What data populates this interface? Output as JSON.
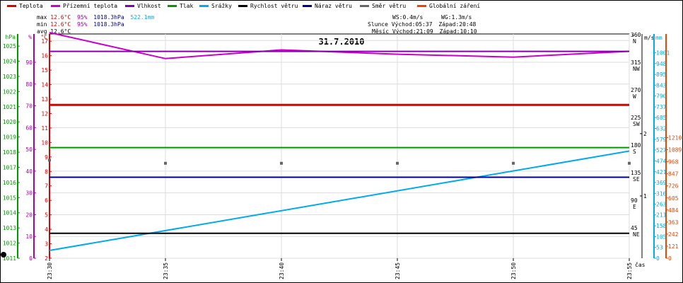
{
  "legend": [
    {
      "label": "Teplota",
      "color": "#dd0000"
    },
    {
      "label": "Přízemní teplota",
      "color": "#cc00cc"
    },
    {
      "label": "Vlhkost",
      "color": "#8800aa"
    },
    {
      "label": "Tlak",
      "color": "#009900"
    },
    {
      "label": "Srážky",
      "color": "#00aaee"
    },
    {
      "label": "Rychlost větru",
      "color": "#000000"
    },
    {
      "label": "Náraz větru",
      "color": "#00008b"
    },
    {
      "label": "Směr větru",
      "color": "#666666"
    },
    {
      "label": "Globální záření",
      "color": "#ee4400"
    }
  ],
  "stats": {
    "max_label": "max",
    "max_temp": "12.6°C",
    "max_hum": "95%",
    "max_press": "1018.3hPa",
    "max_rain": "522.1mm",
    "min_label": "min",
    "min_temp": "12.6°C",
    "min_hum": "95%",
    "min_press": "1018.3hPa",
    "avg_label": "avg",
    "avg_temp": "12.6°C",
    "ws": "WS:0.4m/s",
    "wg": "WG:1.3m/s",
    "sun_label": "Slunce",
    "sun_rise": "Východ:05:37",
    "sun_set": "Západ:20:48",
    "moon_label": "Měsíc",
    "moon_rise": "Východ:21:09",
    "moon_set": "Západ:10:10"
  },
  "axis_units": {
    "hpa": "hPa",
    "pct": "%",
    "deg_c": "°C",
    "deg": "°",
    "ms": "m/s",
    "mm": "mm",
    "cas": "čas"
  },
  "colors": {
    "pressure_axis": "#009900",
    "humidity_axis": "#aa00aa",
    "temp_axis": "#dd0000",
    "rain_axis": "#00aaee",
    "radiation_axis": "#ee4400",
    "grid": "#dddddd"
  },
  "chart_data": {
    "type": "line",
    "title": "31.7.2010",
    "x": [
      "23:30",
      "23:35",
      "23:40",
      "23:45",
      "23:50",
      "23:55"
    ],
    "axes": {
      "pressure_hpa": {
        "ticks": [
          1011,
          1012,
          1013,
          1014,
          1015,
          1016,
          1017,
          1018,
          1019,
          1020,
          1021,
          1022,
          1023,
          1024,
          1025
        ],
        "range": [
          1011,
          1025.8
        ]
      },
      "humidity_pct": {
        "ticks": [
          0,
          10,
          20,
          30,
          40,
          50,
          60,
          70,
          80,
          90,
          100
        ],
        "range": [
          0,
          103
        ]
      },
      "temperature_c": {
        "ticks": [
          2,
          3,
          4,
          5,
          6,
          7,
          8,
          9,
          10,
          11,
          12,
          13,
          14,
          15,
          16,
          17
        ],
        "range": [
          2,
          17.5
        ]
      },
      "wind_direction_deg": {
        "ticks": [
          45,
          90,
          135,
          180,
          225,
          270,
          315,
          360
        ],
        "labels": [
          "NE",
          "E",
          "SE",
          "S",
          "SW",
          "W",
          "NW",
          "N"
        ],
        "range": [
          0,
          366
        ]
      },
      "wind_speed_ms": {
        "ticks": [
          1,
          2
        ],
        "range": [
          0,
          3.6
        ]
      },
      "rain_mm": {
        "ticks": [
          0,
          53,
          105,
          158,
          211,
          263,
          316,
          369,
          421,
          474,
          527,
          579,
          632,
          685,
          737,
          790,
          843,
          895,
          948,
          1001,
          1053
        ],
        "range": [
          0,
          1092
        ]
      },
      "radiation": {
        "ticks": [
          0,
          121,
          242,
          363,
          484,
          605,
          726,
          847,
          968,
          1089,
          1210
        ],
        "range": [
          0,
          2250
        ]
      }
    },
    "series": [
      {
        "name": "Teplota",
        "axis": "temperature_c",
        "x": [
          "23:30",
          "23:55"
        ],
        "y": [
          12.6,
          12.6
        ]
      },
      {
        "name": "Přízemní teplota",
        "axis": "temperature_c",
        "x": [
          "23:30",
          "23:35",
          "23:40",
          "23:45",
          "23:50",
          "23:55"
        ],
        "y": [
          17.6,
          15.8,
          16.4,
          16.1,
          15.9,
          16.3
        ]
      },
      {
        "name": "Vlhkost",
        "axis": "humidity_pct",
        "x": [
          "23:30",
          "23:55"
        ],
        "y": [
          95,
          95
        ]
      },
      {
        "name": "Tlak",
        "axis": "pressure_hpa",
        "x": [
          "23:30",
          "23:55"
        ],
        "y": [
          1018.3,
          1018.3
        ]
      },
      {
        "name": "Srážky",
        "axis": "rain_mm",
        "x": [
          "23:30",
          "23:55"
        ],
        "y": [
          38,
          522
        ]
      },
      {
        "name": "Rychlost větru",
        "axis": "wind_speed_ms",
        "x": [
          "23:30",
          "23:55"
        ],
        "y": [
          0.4,
          0.4
        ]
      },
      {
        "name": "Náraz větru",
        "axis": "wind_speed_ms",
        "x": [
          "23:30",
          "23:55"
        ],
        "y": [
          1.3,
          1.3
        ]
      },
      {
        "name": "Směr větru",
        "axis": "wind_direction_deg",
        "x": [
          "23:30",
          "23:35",
          "23:40",
          "23:45",
          "23:50",
          "23:55"
        ],
        "y": [
          160,
          155,
          155,
          155,
          155,
          155
        ]
      }
    ]
  }
}
